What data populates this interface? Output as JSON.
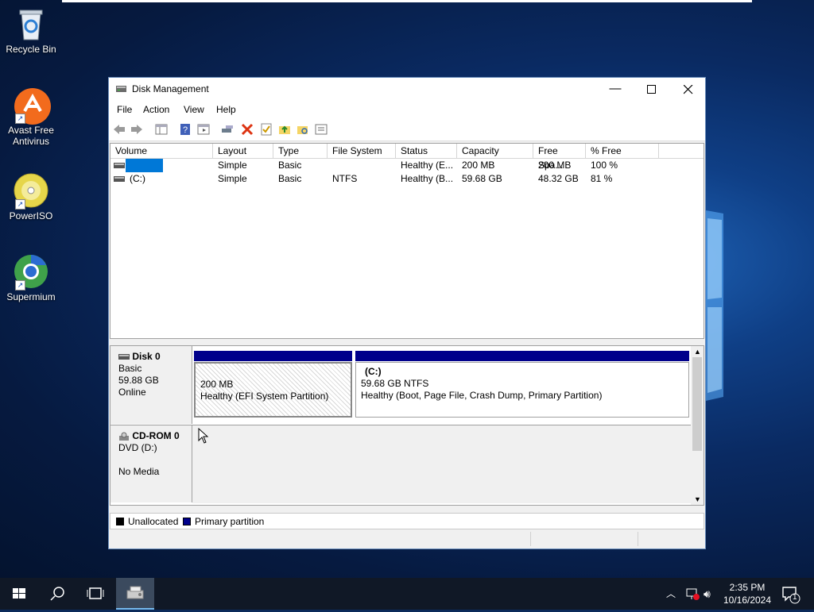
{
  "desktop": {
    "icons": [
      {
        "label": "Recycle Bin",
        "icon": "recycle-bin-icon"
      },
      {
        "label": "Avast Free\nAntivirus",
        "icon": "avast-icon"
      },
      {
        "label": "PowerISO",
        "icon": "poweriso-icon"
      },
      {
        "label": "Supermium",
        "icon": "supermium-icon"
      }
    ]
  },
  "window": {
    "title": "Disk Management",
    "menu": [
      "File",
      "Action",
      "View",
      "Help"
    ]
  },
  "volume_list": {
    "columns": [
      "Volume",
      "Layout",
      "Type",
      "File System",
      "Status",
      "Capacity",
      "Free Spa...",
      "% Free"
    ],
    "rows": [
      {
        "volume": "",
        "layout": "Simple",
        "type": "Basic",
        "fs": "",
        "status": "Healthy (E...",
        "capacity": "200 MB",
        "free": "200 MB",
        "pct": "100 %",
        "selected": true
      },
      {
        "volume": "(C:)",
        "layout": "Simple",
        "type": "Basic",
        "fs": "NTFS",
        "status": "Healthy (B...",
        "capacity": "59.68 GB",
        "free": "48.32 GB",
        "pct": "81 %",
        "selected": false
      }
    ]
  },
  "disks": [
    {
      "name": "Disk 0",
      "type": "Basic",
      "size": "59.88 GB",
      "state": "Online",
      "partitions": [
        {
          "title": "",
          "size": "200 MB",
          "status": "Healthy (EFI System Partition)"
        },
        {
          "title": "(C:)",
          "size": "59.68 GB NTFS",
          "status": "Healthy (Boot, Page File, Crash Dump, Primary Partition)"
        }
      ]
    },
    {
      "name": "CD-ROM 0",
      "type": "DVD (D:)",
      "size": "",
      "state": "No Media"
    }
  ],
  "legend": {
    "unallocated": "Unallocated",
    "primary": "Primary partition",
    "unallocated_color": "#000000",
    "primary_color": "#00008b"
  },
  "taskbar": {
    "time": "2:35 PM",
    "date": "10/16/2024",
    "notification_count": "1"
  },
  "colors": {
    "partition_header": "#00008b",
    "selection": "#0078d7"
  }
}
